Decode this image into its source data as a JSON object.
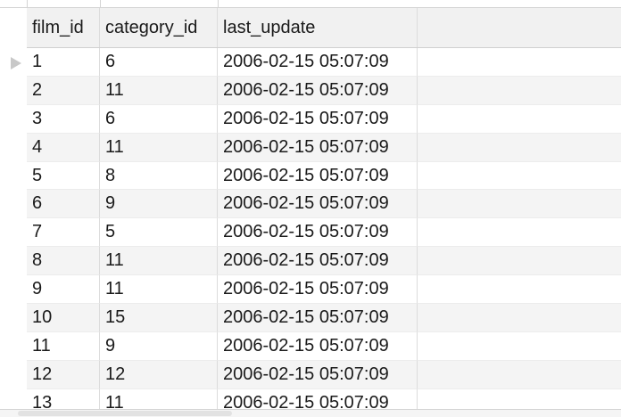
{
  "columns": [
    "film_id",
    "category_id",
    "last_update"
  ],
  "rows": [
    {
      "film_id": "1",
      "category_id": "6",
      "last_update": "2006-02-15 05:07:09"
    },
    {
      "film_id": "2",
      "category_id": "11",
      "last_update": "2006-02-15 05:07:09"
    },
    {
      "film_id": "3",
      "category_id": "6",
      "last_update": "2006-02-15 05:07:09"
    },
    {
      "film_id": "4",
      "category_id": "11",
      "last_update": "2006-02-15 05:07:09"
    },
    {
      "film_id": "5",
      "category_id": "8",
      "last_update": "2006-02-15 05:07:09"
    },
    {
      "film_id": "6",
      "category_id": "9",
      "last_update": "2006-02-15 05:07:09"
    },
    {
      "film_id": "7",
      "category_id": "5",
      "last_update": "2006-02-15 05:07:09"
    },
    {
      "film_id": "8",
      "category_id": "11",
      "last_update": "2006-02-15 05:07:09"
    },
    {
      "film_id": "9",
      "category_id": "11",
      "last_update": "2006-02-15 05:07:09"
    },
    {
      "film_id": "10",
      "category_id": "15",
      "last_update": "2006-02-15 05:07:09"
    },
    {
      "film_id": "11",
      "category_id": "9",
      "last_update": "2006-02-15 05:07:09"
    },
    {
      "film_id": "12",
      "category_id": "12",
      "last_update": "2006-02-15 05:07:09"
    },
    {
      "film_id": "13",
      "category_id": "11",
      "last_update": "2006-02-15 05:07:09"
    }
  ],
  "colors": {
    "header_bg": "#f1f1f1",
    "alt_row_bg": "#f4f4f4",
    "grid_line": "#dcdcdc"
  },
  "icons": {
    "current_row_marker": "triangle-right-icon"
  }
}
